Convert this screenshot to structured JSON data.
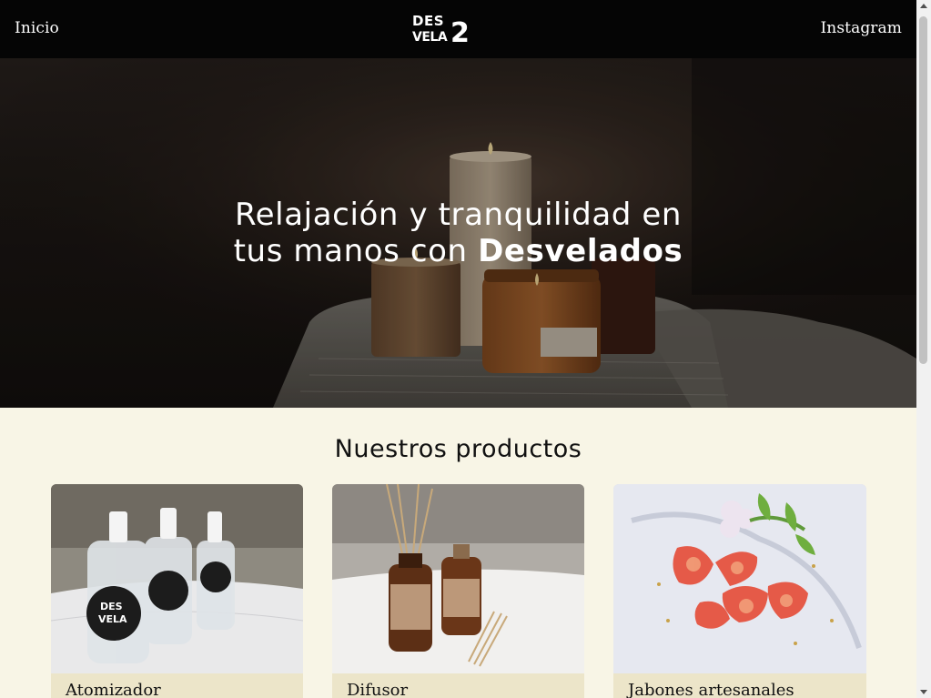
{
  "header": {
    "home_label": "Inicio",
    "instagram_label": "Instagram",
    "logo": {
      "line1": "DES",
      "line2": "VELA",
      "mark": "2"
    }
  },
  "hero": {
    "title_line1": "Relajación y tranquilidad en",
    "title_line2_prefix": "tus manos con ",
    "title_brand": "Desvelados"
  },
  "products": {
    "heading": "Nuestros productos",
    "items": [
      {
        "title": "Atomizador",
        "image": "spray-bottles-photo"
      },
      {
        "title": "Difusor",
        "image": "reed-diffuser-photo"
      },
      {
        "title": "Jabones artesanales",
        "image": "artisan-soaps-photo"
      }
    ]
  },
  "colors": {
    "header_bg": "#050505",
    "page_bg": "#f8f5e6",
    "card_caption_bg": "#ece5c9"
  }
}
